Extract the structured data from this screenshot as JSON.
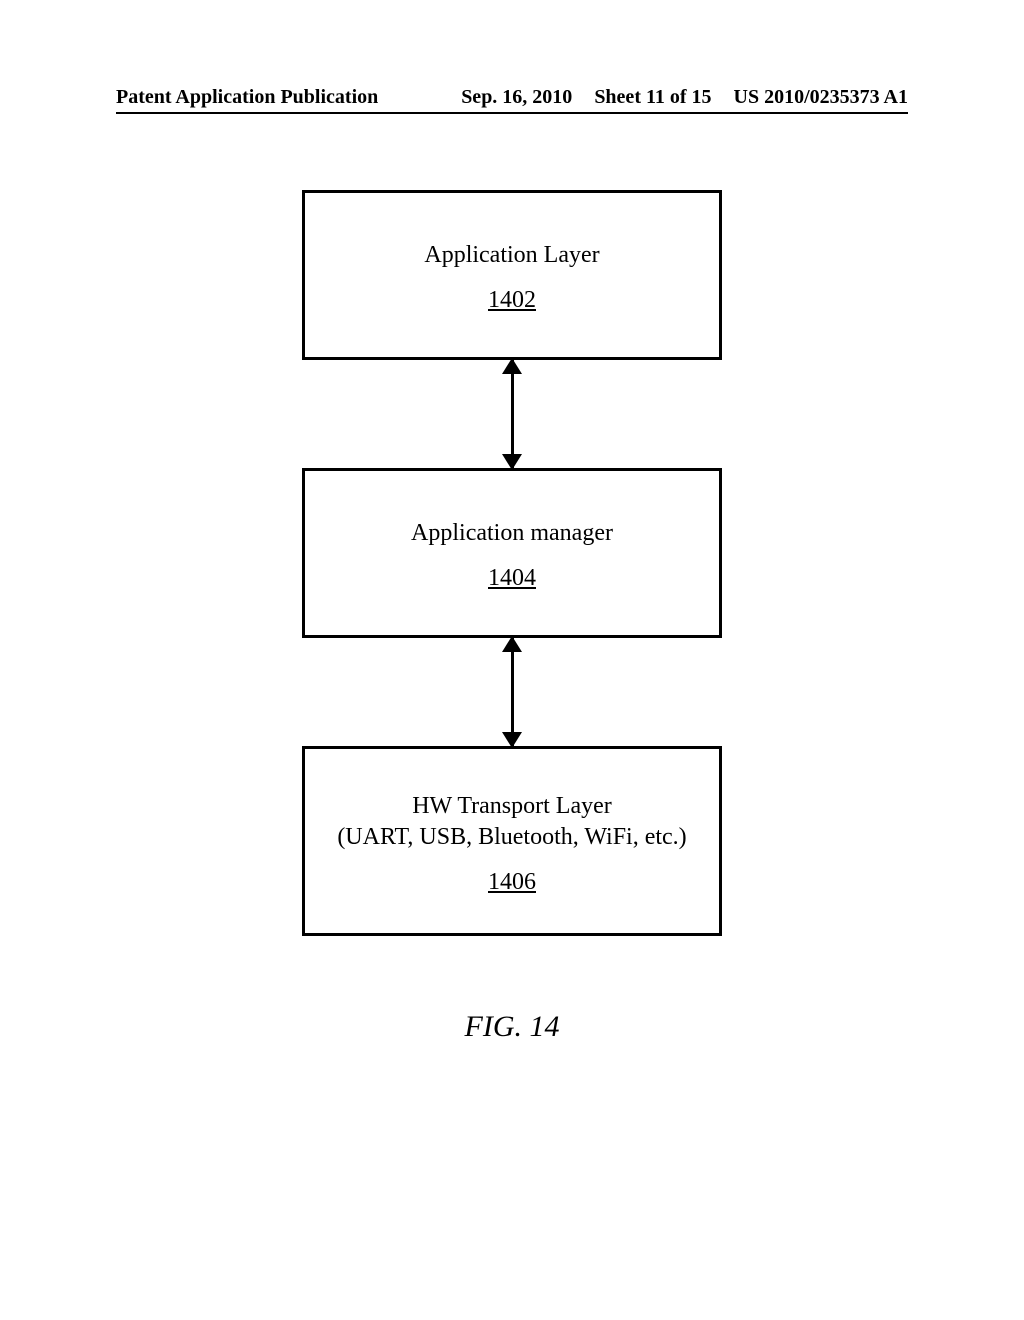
{
  "header": {
    "left": "Patent Application Publication",
    "date": "Sep. 16, 2010",
    "sheet": "Sheet 11 of 15",
    "pubno": "US 2010/0235373 A1"
  },
  "boxes": {
    "b1": {
      "title": "Application Layer",
      "ref": "1402"
    },
    "b2": {
      "title": "Application manager",
      "ref": "1404"
    },
    "b3": {
      "title": "HW Transport Layer",
      "subtitle": "(UART, USB, Bluetooth, WiFi, etc.)",
      "ref": "1406"
    }
  },
  "caption": "FIG. 14"
}
